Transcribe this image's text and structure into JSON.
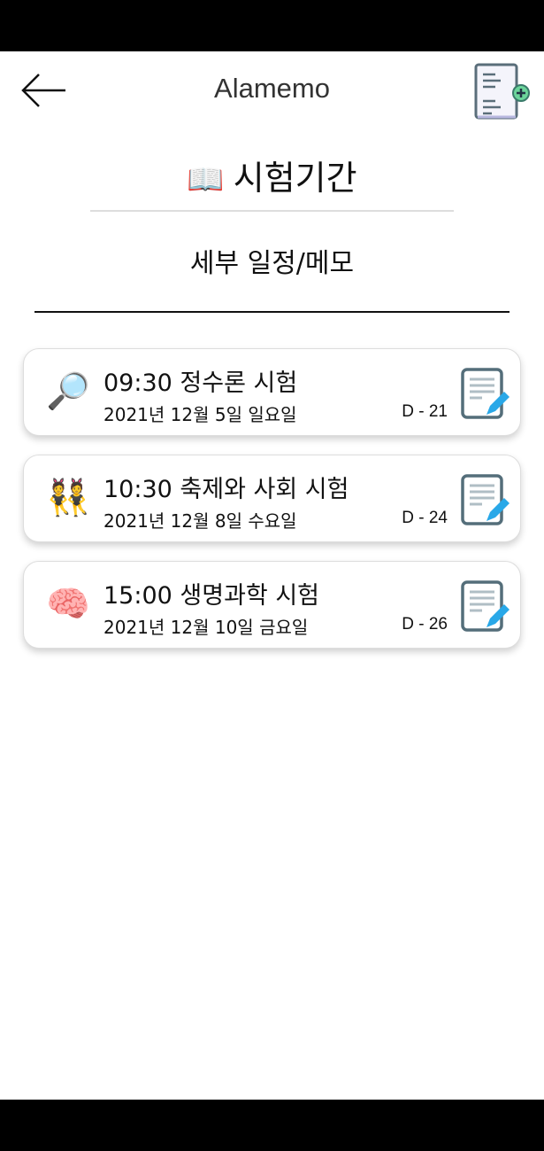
{
  "header": {
    "title": "Alamemo"
  },
  "page": {
    "title_emoji": "📖",
    "title": "시험기간",
    "subtitle": "세부 일정/메모"
  },
  "items": [
    {
      "icon": "🔎",
      "time_title": "09:30 정수론 시험",
      "date": "2021년 12월 5일 일요일",
      "dday": "D - 21"
    },
    {
      "icon": "👯",
      "time_title": "10:30 축제와 사회 시험",
      "date": "2021년 12월 8일 수요일",
      "dday": "D - 24"
    },
    {
      "icon": "🧠",
      "time_title": "15:00 생명과학 시험",
      "date": "2021년 12월 10일 금요일",
      "dday": "D - 26"
    }
  ]
}
